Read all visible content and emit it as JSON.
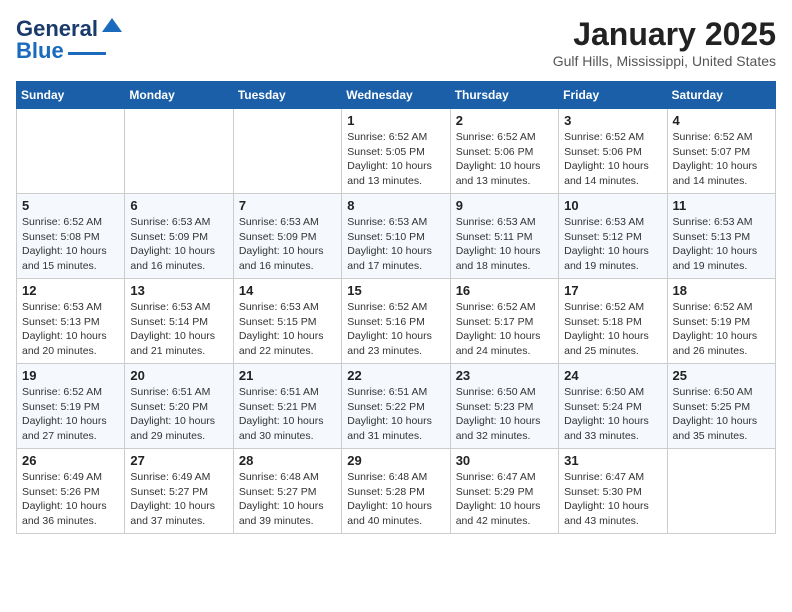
{
  "header": {
    "logo_general": "General",
    "logo_blue": "Blue",
    "month": "January 2025",
    "location": "Gulf Hills, Mississippi, United States"
  },
  "weekdays": [
    "Sunday",
    "Monday",
    "Tuesday",
    "Wednesday",
    "Thursday",
    "Friday",
    "Saturday"
  ],
  "weeks": [
    [
      {
        "day": "",
        "info": ""
      },
      {
        "day": "",
        "info": ""
      },
      {
        "day": "",
        "info": ""
      },
      {
        "day": "1",
        "info": "Sunrise: 6:52 AM\nSunset: 5:05 PM\nDaylight: 10 hours\nand 13 minutes."
      },
      {
        "day": "2",
        "info": "Sunrise: 6:52 AM\nSunset: 5:06 PM\nDaylight: 10 hours\nand 13 minutes."
      },
      {
        "day": "3",
        "info": "Sunrise: 6:52 AM\nSunset: 5:06 PM\nDaylight: 10 hours\nand 14 minutes."
      },
      {
        "day": "4",
        "info": "Sunrise: 6:52 AM\nSunset: 5:07 PM\nDaylight: 10 hours\nand 14 minutes."
      }
    ],
    [
      {
        "day": "5",
        "info": "Sunrise: 6:52 AM\nSunset: 5:08 PM\nDaylight: 10 hours\nand 15 minutes."
      },
      {
        "day": "6",
        "info": "Sunrise: 6:53 AM\nSunset: 5:09 PM\nDaylight: 10 hours\nand 16 minutes."
      },
      {
        "day": "7",
        "info": "Sunrise: 6:53 AM\nSunset: 5:09 PM\nDaylight: 10 hours\nand 16 minutes."
      },
      {
        "day": "8",
        "info": "Sunrise: 6:53 AM\nSunset: 5:10 PM\nDaylight: 10 hours\nand 17 minutes."
      },
      {
        "day": "9",
        "info": "Sunrise: 6:53 AM\nSunset: 5:11 PM\nDaylight: 10 hours\nand 18 minutes."
      },
      {
        "day": "10",
        "info": "Sunrise: 6:53 AM\nSunset: 5:12 PM\nDaylight: 10 hours\nand 19 minutes."
      },
      {
        "day": "11",
        "info": "Sunrise: 6:53 AM\nSunset: 5:13 PM\nDaylight: 10 hours\nand 19 minutes."
      }
    ],
    [
      {
        "day": "12",
        "info": "Sunrise: 6:53 AM\nSunset: 5:13 PM\nDaylight: 10 hours\nand 20 minutes."
      },
      {
        "day": "13",
        "info": "Sunrise: 6:53 AM\nSunset: 5:14 PM\nDaylight: 10 hours\nand 21 minutes."
      },
      {
        "day": "14",
        "info": "Sunrise: 6:53 AM\nSunset: 5:15 PM\nDaylight: 10 hours\nand 22 minutes."
      },
      {
        "day": "15",
        "info": "Sunrise: 6:52 AM\nSunset: 5:16 PM\nDaylight: 10 hours\nand 23 minutes."
      },
      {
        "day": "16",
        "info": "Sunrise: 6:52 AM\nSunset: 5:17 PM\nDaylight: 10 hours\nand 24 minutes."
      },
      {
        "day": "17",
        "info": "Sunrise: 6:52 AM\nSunset: 5:18 PM\nDaylight: 10 hours\nand 25 minutes."
      },
      {
        "day": "18",
        "info": "Sunrise: 6:52 AM\nSunset: 5:19 PM\nDaylight: 10 hours\nand 26 minutes."
      }
    ],
    [
      {
        "day": "19",
        "info": "Sunrise: 6:52 AM\nSunset: 5:19 PM\nDaylight: 10 hours\nand 27 minutes."
      },
      {
        "day": "20",
        "info": "Sunrise: 6:51 AM\nSunset: 5:20 PM\nDaylight: 10 hours\nand 29 minutes."
      },
      {
        "day": "21",
        "info": "Sunrise: 6:51 AM\nSunset: 5:21 PM\nDaylight: 10 hours\nand 30 minutes."
      },
      {
        "day": "22",
        "info": "Sunrise: 6:51 AM\nSunset: 5:22 PM\nDaylight: 10 hours\nand 31 minutes."
      },
      {
        "day": "23",
        "info": "Sunrise: 6:50 AM\nSunset: 5:23 PM\nDaylight: 10 hours\nand 32 minutes."
      },
      {
        "day": "24",
        "info": "Sunrise: 6:50 AM\nSunset: 5:24 PM\nDaylight: 10 hours\nand 33 minutes."
      },
      {
        "day": "25",
        "info": "Sunrise: 6:50 AM\nSunset: 5:25 PM\nDaylight: 10 hours\nand 35 minutes."
      }
    ],
    [
      {
        "day": "26",
        "info": "Sunrise: 6:49 AM\nSunset: 5:26 PM\nDaylight: 10 hours\nand 36 minutes."
      },
      {
        "day": "27",
        "info": "Sunrise: 6:49 AM\nSunset: 5:27 PM\nDaylight: 10 hours\nand 37 minutes."
      },
      {
        "day": "28",
        "info": "Sunrise: 6:48 AM\nSunset: 5:27 PM\nDaylight: 10 hours\nand 39 minutes."
      },
      {
        "day": "29",
        "info": "Sunrise: 6:48 AM\nSunset: 5:28 PM\nDaylight: 10 hours\nand 40 minutes."
      },
      {
        "day": "30",
        "info": "Sunrise: 6:47 AM\nSunset: 5:29 PM\nDaylight: 10 hours\nand 42 minutes."
      },
      {
        "day": "31",
        "info": "Sunrise: 6:47 AM\nSunset: 5:30 PM\nDaylight: 10 hours\nand 43 minutes."
      },
      {
        "day": "",
        "info": ""
      }
    ]
  ]
}
